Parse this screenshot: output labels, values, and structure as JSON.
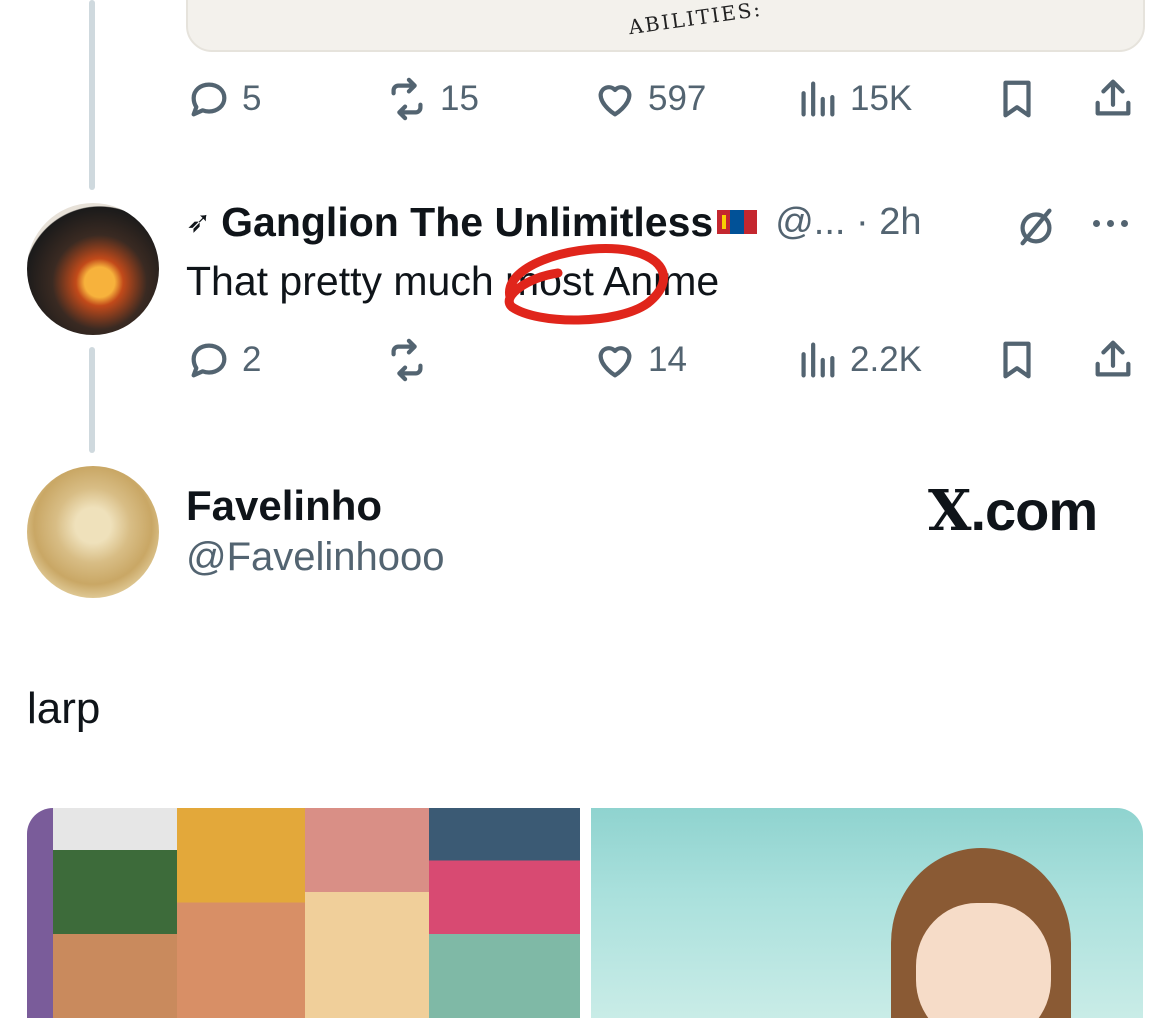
{
  "top_media": {
    "caption": "ABILITIES:"
  },
  "first_tweet_actions": {
    "replies": "5",
    "reposts": "15",
    "likes": "597",
    "views": "15K"
  },
  "reply_tweet": {
    "prefix_emoji": "➶",
    "display_name": "Ganglion The Unlimitless",
    "handle_time": "@... · 2h",
    "text": "That pretty much most Anime",
    "actions": {
      "replies": "2",
      "reposts": "",
      "likes": "14",
      "views": "2.2K"
    }
  },
  "quoted_tweet": {
    "display_name": "Favelinho",
    "handle": "@Favelinhooo",
    "brand": ".com",
    "brand_mark": "X",
    "text": "larp"
  },
  "colors": {
    "text_primary": "#0f1419",
    "text_secondary": "#536471",
    "thread_line": "#cfd9de",
    "annotation": "#e0251b"
  },
  "icons": [
    "reply-icon",
    "repost-icon",
    "like-icon",
    "views-icon",
    "bookmark-icon",
    "share-icon",
    "grok-icon",
    "more-icon"
  ]
}
